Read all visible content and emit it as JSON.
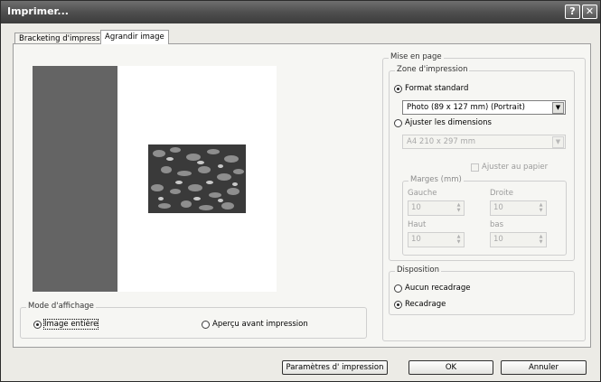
{
  "window": {
    "title": "Imprimer...",
    "help_button": "?",
    "close_button": "✕"
  },
  "tabs": [
    {
      "label": "Bracketing d'impression",
      "active": false
    },
    {
      "label": "Agrandir image",
      "active": true
    }
  ],
  "mode_affichage": {
    "legend": "Mode d'affichage",
    "options": [
      {
        "label": "Image entière",
        "selected": true
      },
      {
        "label": "Aperçu avant impression",
        "selected": false
      }
    ]
  },
  "mise_en_page": {
    "legend": "Mise en page",
    "zone": {
      "legend": "Zone d'impression",
      "format_standard_label": "Format standard",
      "format_standard_selected": true,
      "format_value": "Photo (89 x 127 mm) (Portrait)",
      "ajuster_label": "Ajuster les dimensions",
      "ajuster_selected": false,
      "paper_value": "A4 210 x 297 mm",
      "fit_paper_label": "Ajuster au papier",
      "margins": {
        "legend": "Marges (mm)",
        "gauche_label": "Gauche",
        "gauche_value": "10",
        "droite_label": "Droite",
        "droite_value": "10",
        "haut_label": "Haut",
        "haut_value": "10",
        "bas_label": "bas",
        "bas_value": "10"
      }
    }
  },
  "disposition": {
    "legend": "Disposition",
    "options": [
      {
        "label": "Aucun recadrage",
        "selected": false
      },
      {
        "label": "Recadrage",
        "selected": true
      }
    ]
  },
  "buttons": {
    "params": "Paramètres d' impression",
    "ok": "OK",
    "cancel": "Annuler"
  },
  "colors": {
    "preview_background": "#646464",
    "paper": "#ffffff",
    "titlebar": "#4f4f4f"
  }
}
